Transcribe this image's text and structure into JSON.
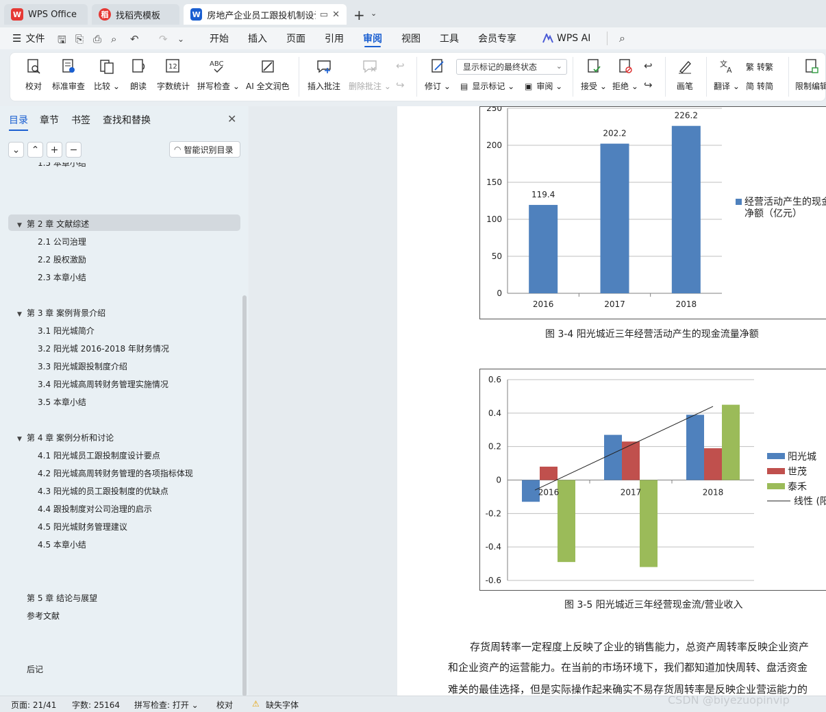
{
  "tabs": [
    {
      "label": "WPS Office",
      "logo": "W",
      "color": "#e53935"
    },
    {
      "label": "找稻壳模板",
      "logo": "稻",
      "color": "#e53935"
    },
    {
      "label": "房地产企业员工跟投机制设计...",
      "logo": "W",
      "color": "#1a5fd1"
    }
  ],
  "menu": {
    "file_label": "文件",
    "items": [
      "开始",
      "插入",
      "页面",
      "引用",
      "审阅",
      "视图",
      "工具",
      "会员专享",
      "WPS AI"
    ],
    "active": "审阅"
  },
  "ribbon": {
    "proofread": "校对",
    "standard_review": "标准审查",
    "compare": "比较",
    "read_aloud": "朗读",
    "word_count": "字数统计",
    "spell_check": "拼写检查",
    "ai_polish": "AI 全文润色",
    "insert_comment": "插入批注",
    "delete_comment": "删除批注",
    "track_changes": "修订",
    "markup_state": "显示标记的最终状态",
    "show_markup": "显示标记",
    "review": "审阅",
    "accept": "接受",
    "reject": "拒绝",
    "pen": "画笔",
    "translate": "翻译",
    "to_traditional": "转繁",
    "to_simplified": "转简",
    "restrict_edit": "限制编辑",
    "word_count_icon_text": "12",
    "spell_icon_text": "ABC"
  },
  "nav": {
    "tabs": [
      "目录",
      "章节",
      "书签",
      "查找和替换"
    ],
    "smart_toc": "智能识别目录",
    "toc_partial": "1.5  本章小结",
    "toc": [
      {
        "text": "第 2 章  文献综述",
        "level": 1,
        "expanded": true,
        "selected": true
      },
      {
        "text": "2.1  公司治理",
        "level": 2
      },
      {
        "text": "2.2  股权激励",
        "level": 2
      },
      {
        "text": "2.3  本章小结",
        "level": 2
      },
      {
        "text": "第 3 章  案例背景介绍",
        "level": 1,
        "expanded": true
      },
      {
        "text": "3.1  阳光城简介",
        "level": 2
      },
      {
        "text": "3.2  阳光城 2016-2018 年财务情况",
        "level": 2
      },
      {
        "text": "3.3  阳光城跟投制度介绍",
        "level": 2
      },
      {
        "text": "3.4  阳光城高周转财务管理实施情况",
        "level": 2
      },
      {
        "text": "3.5  本章小结",
        "level": 2
      },
      {
        "text": "第 4 章  案例分析和讨论",
        "level": 1,
        "expanded": true
      },
      {
        "text": "4.1  阳光城员工跟投制度设计要点",
        "level": 2
      },
      {
        "text": "4.2  阳光城高周转财务管理的各项指标体现",
        "level": 2
      },
      {
        "text": "4.3  阳光城的员工跟投制度的优缺点",
        "level": 2
      },
      {
        "text": "4.4  跟投制度对公司治理的启示",
        "level": 2
      },
      {
        "text": "4.5  阳光城财务管理建议",
        "level": 2
      },
      {
        "text": "4.5  本章小结",
        "level": 2
      },
      {
        "text": "第 5 章  结论与展望",
        "level": 1
      },
      {
        "text": "参考文献",
        "level": 1
      },
      {
        "text": "后记",
        "level": 1
      }
    ]
  },
  "chart_data": [
    {
      "type": "bar",
      "categories": [
        "2016",
        "2017",
        "2018"
      ],
      "series": [
        {
          "name": "经营活动产生的现金流量净额（亿元）",
          "values": [
            119.4,
            202.2,
            226.2
          ],
          "color": "#4f81bd"
        }
      ],
      "legend_lines": [
        "经营活动产生的现金",
        "净额（亿元）"
      ],
      "data_labels": [
        "119.4",
        "202.2",
        "226.2"
      ],
      "ylim": [
        0,
        250
      ],
      "yticks": [
        "0",
        "50",
        "100",
        "150",
        "200",
        "250"
      ],
      "grid": true,
      "legend": "right",
      "caption": "图 3-4    阳光城近三年经营活动产生的现金流量净额"
    },
    {
      "type": "bar",
      "categories": [
        "2016",
        "2017",
        "2018"
      ],
      "series": [
        {
          "name": "阳光城",
          "values": [
            -0.13,
            0.27,
            0.39
          ],
          "color": "#4f81bd"
        },
        {
          "name": "世茂",
          "values": [
            0.08,
            0.23,
            0.19
          ],
          "color": "#c0504d"
        },
        {
          "name": "泰禾",
          "values": [
            -0.49,
            -0.52,
            0.45
          ],
          "color": "#9bbb59"
        }
      ],
      "trendline": {
        "name": "线性 (阳",
        "from": -0.06,
        "to": 0.44
      },
      "ylim": [
        -0.6,
        0.6
      ],
      "yticks": [
        "0.6",
        "0.4",
        "0.2",
        "0",
        "-0.2",
        "-0.4",
        "-0.6"
      ],
      "grid": true,
      "legend": "right",
      "caption": "图 3-5    阳光城近三年经营现金流/营业收入"
    }
  ],
  "body_text": [
    "存货周转率一定程度上反映了企业的销售能力，总资产周转率反映企业资产",
    "和企业资产的运营能力。在当前的市场环境下，我们都知道加快周转、盘活资金",
    "难关的最佳选择，但是实际操作起来确实不易存货周转率是反映企业营运能力的"
  ],
  "status": {
    "page": "页面: 21/41",
    "words": "字数: 25164",
    "spell": "拼写检查: 打开",
    "proof": "校对",
    "missing_font": "缺失字体"
  },
  "watermark": "CSDN @biyezuopinvip"
}
